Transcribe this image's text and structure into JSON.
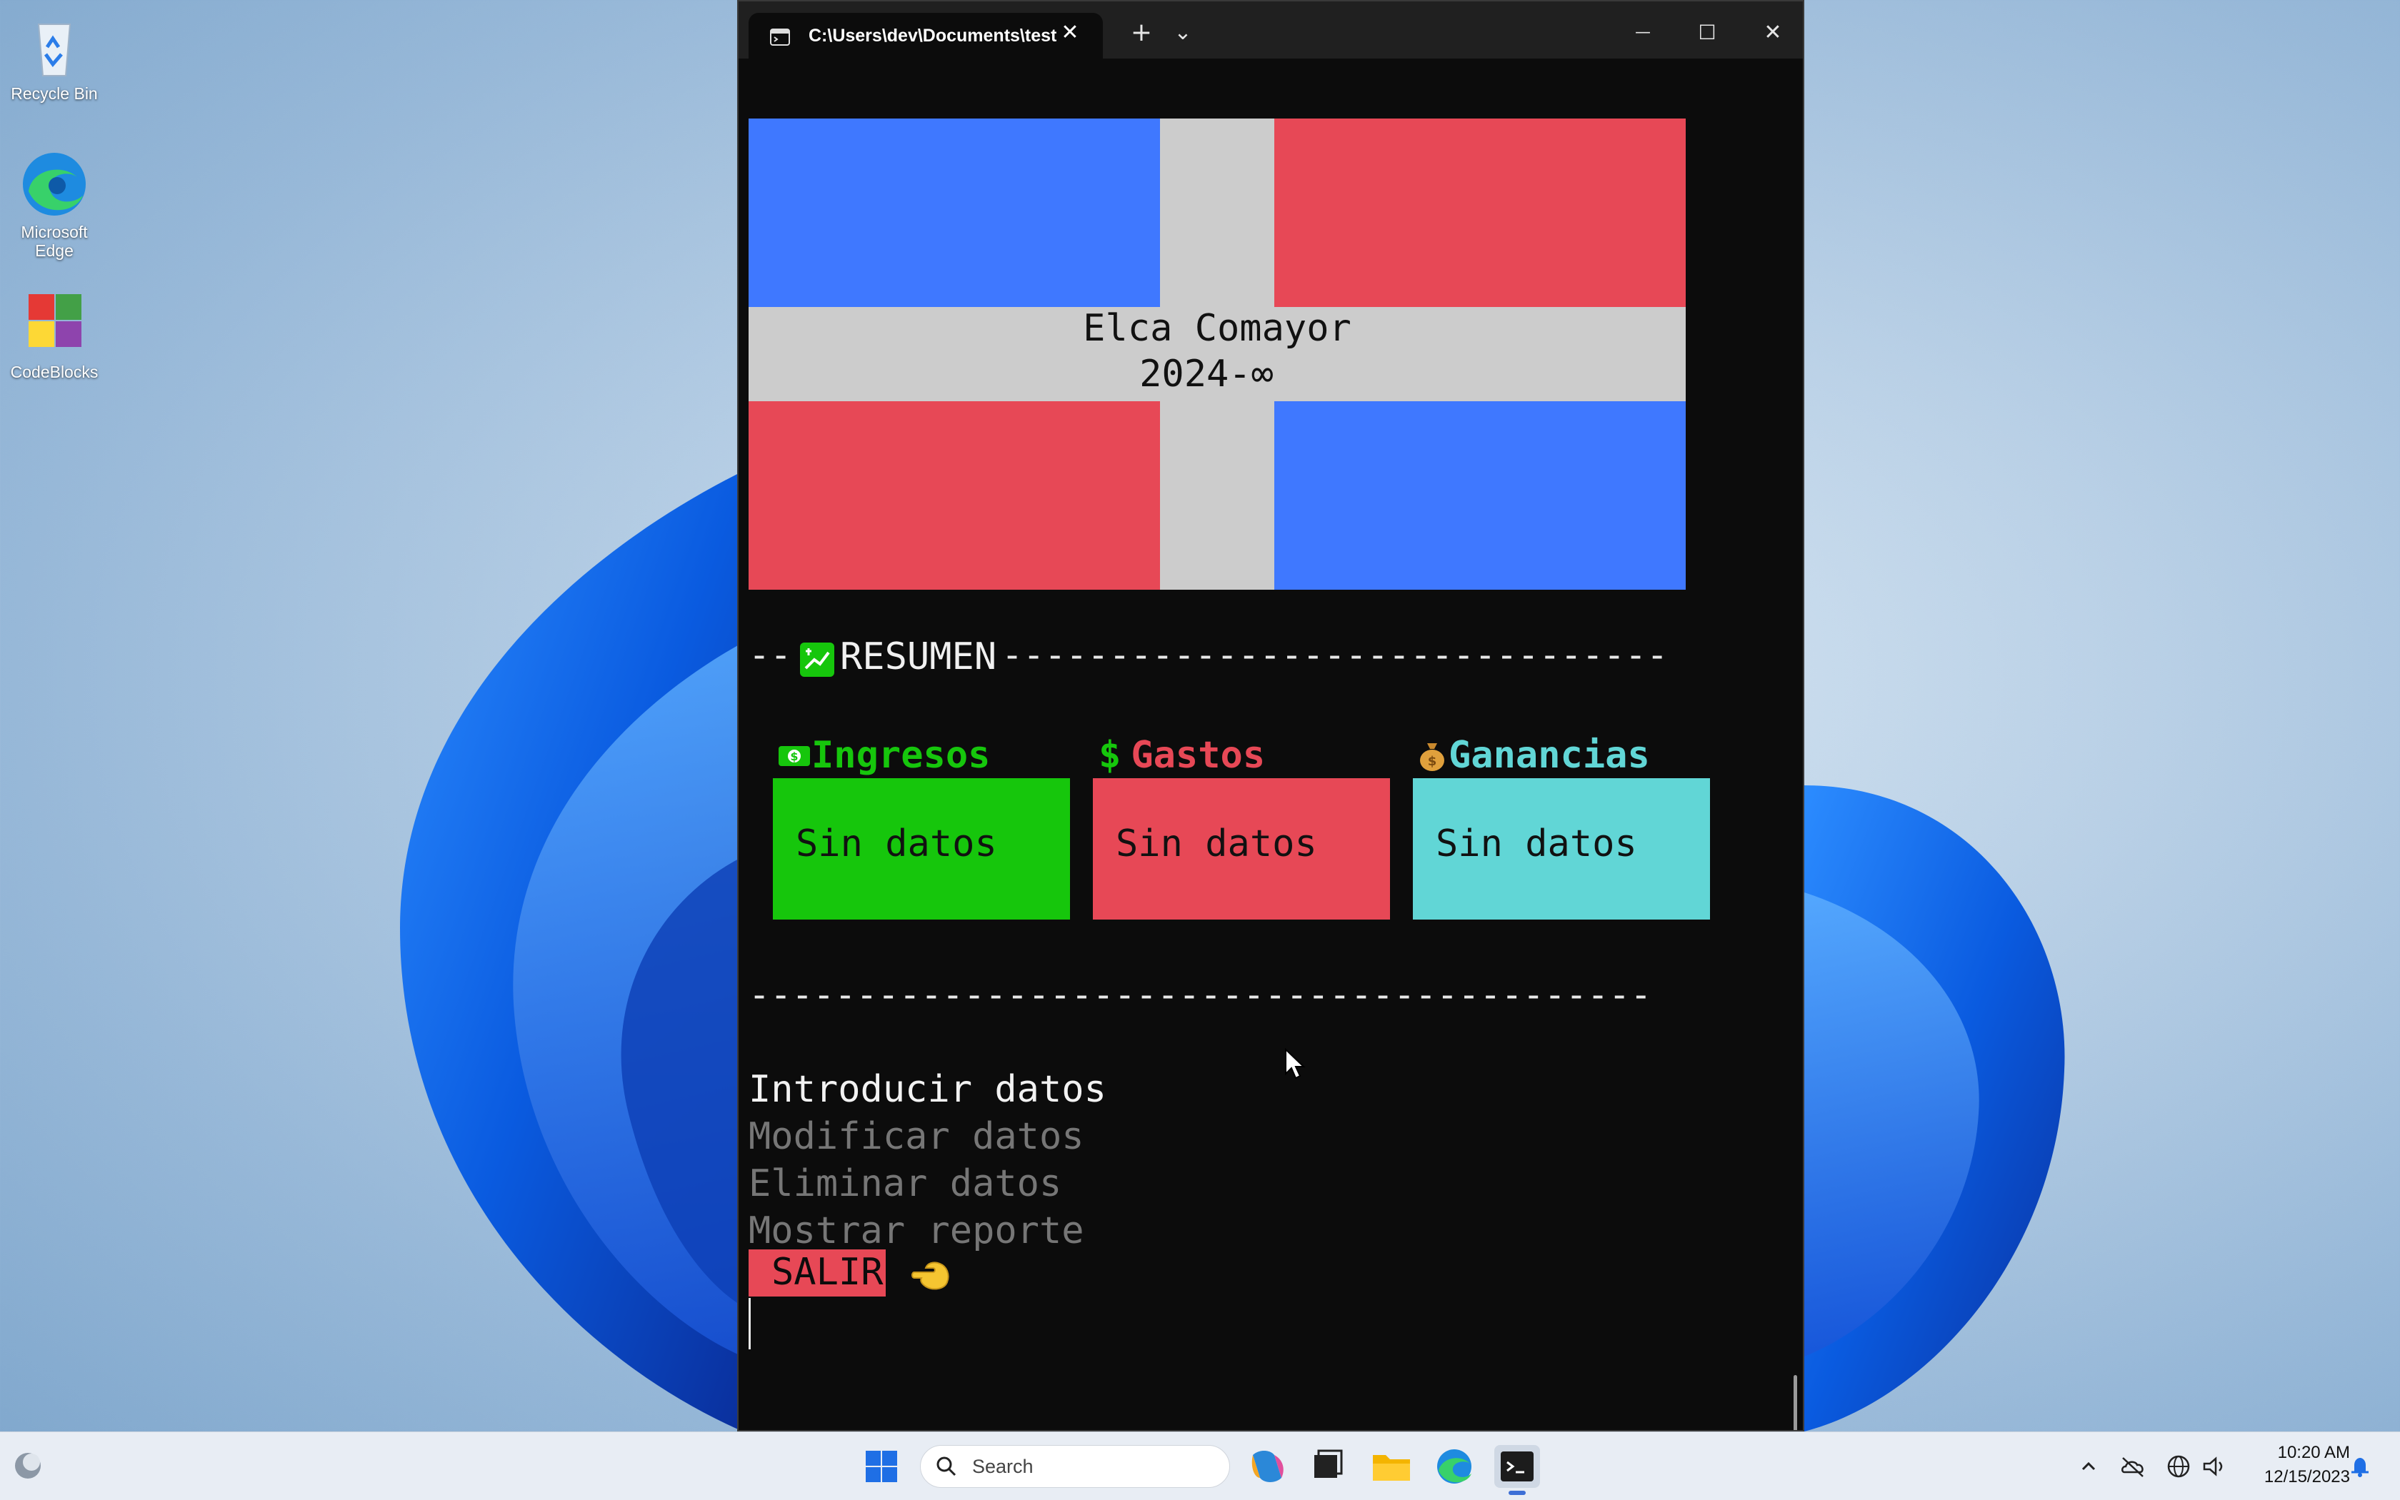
{
  "desktop": {
    "icons": [
      {
        "label": "Recycle Bin",
        "icon": "recycle-bin-icon"
      },
      {
        "label": "Microsoft Edge",
        "icon": "edge-icon"
      },
      {
        "label": "CodeBlocks",
        "icon": "codeblocks-icon"
      }
    ]
  },
  "window": {
    "tab_title": "C:\\Users\\dev\\Documents\\test",
    "new_tab": "+",
    "tab_dropdown": "⌄",
    "minimize": "—",
    "maximize": "☐",
    "close": "✕"
  },
  "terminal": {
    "flag_title_line1": "Elca Comayor",
    "flag_title_line2": "2024-∞",
    "summary_rule_prefix": "--",
    "summary_label": "RESUMEN",
    "summary_rule_suffix": "-------------------------------",
    "bottom_rule": "------------------------------------------",
    "cards": [
      {
        "emoji": "💵",
        "title": "Ingresos",
        "value": "Sin datos",
        "color": "#16c60c"
      },
      {
        "emoji": "$",
        "title": "Gastos",
        "value": "Sin datos",
        "color": "#e74856"
      },
      {
        "emoji": "💰",
        "title": "Ganancias",
        "value": "Sin datos",
        "color": "#61d6d6"
      }
    ],
    "menu": [
      {
        "label": "Introducir datos",
        "selected": true
      },
      {
        "label": "Modificar datos",
        "selected": false
      },
      {
        "label": "Eliminar datos",
        "selected": false
      },
      {
        "label": "Mostrar reporte",
        "selected": false
      }
    ],
    "exit_label": "SALIR",
    "colors": {
      "blue": "#3f78ff",
      "red": "#e74856",
      "white": "#cccccc",
      "background": "#0c0c0c"
    }
  },
  "taskbar": {
    "search_placeholder": "Search",
    "time": "10:20 AM",
    "date": "12/15/2023"
  }
}
